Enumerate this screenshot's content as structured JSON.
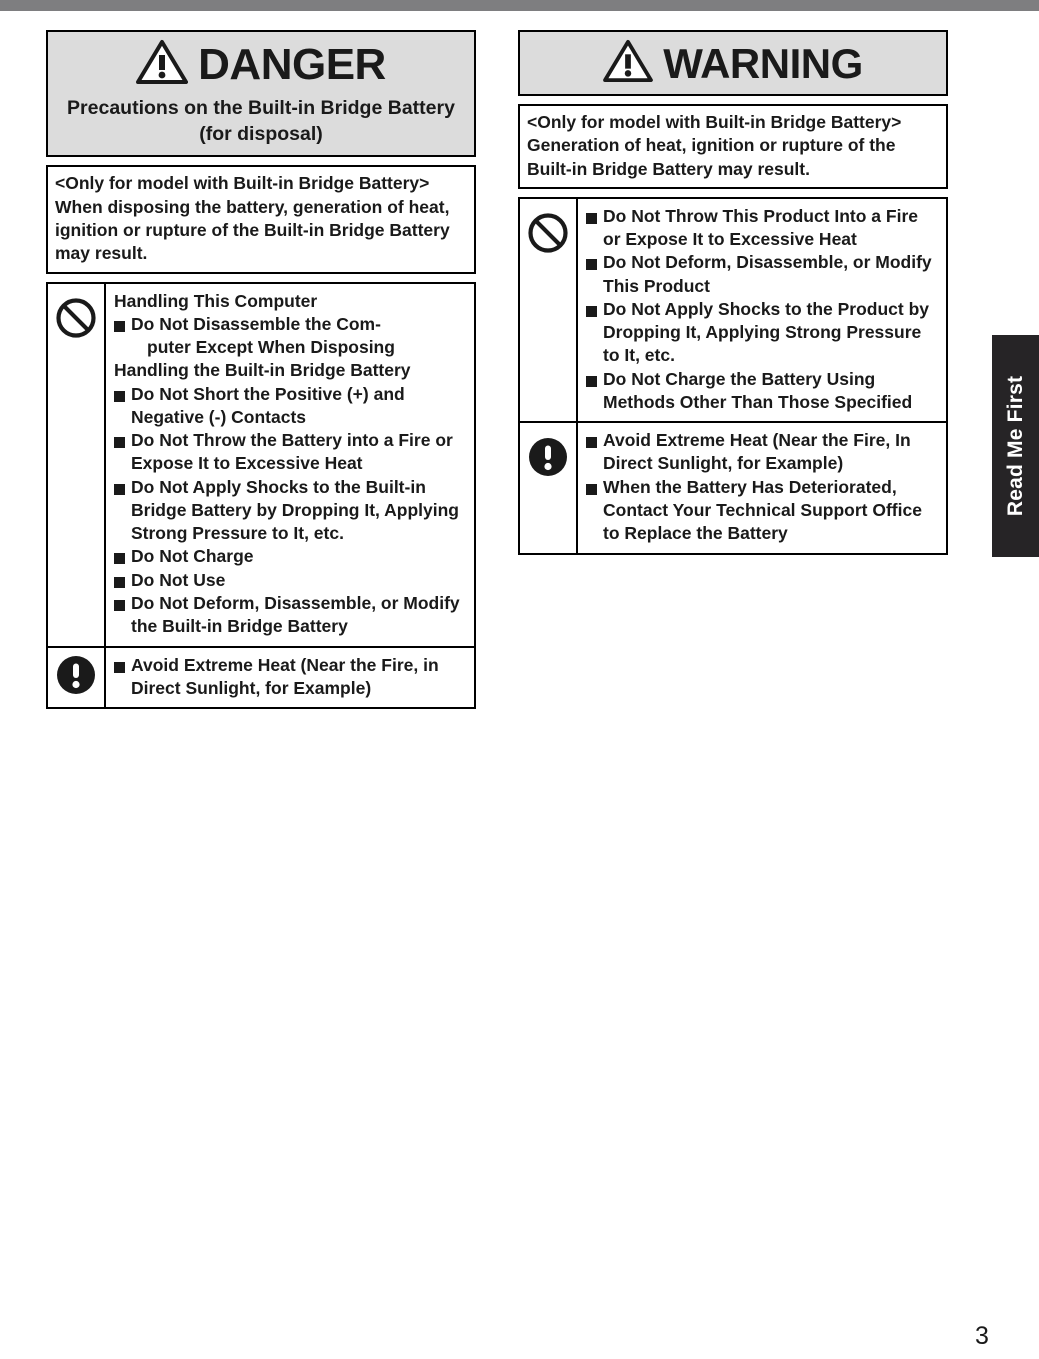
{
  "page": {
    "number": "3",
    "side_tab_label": "Read Me First"
  },
  "danger_panel": {
    "signal_word": "DANGER",
    "signal_icon": "warning-triangle-icon",
    "subtitle": "Precautions on the Built-in Bridge Battery (for disposal)",
    "statement": [
      "<Only for model with Built-in Bridge Battery>",
      "When disposing the battery, generation of heat, ignition or rupture of the Built-in Bridge Battery may result."
    ],
    "rows": [
      {
        "icon": "prohibition-icon",
        "heading_1": "Handling This Computer",
        "bullets_1": [
          {
            "main": "Do Not Disassemble the Com-",
            "cont": "puter Except When Disposing"
          }
        ],
        "heading_2": "Handling the Built-in Bridge Battery",
        "bullets_2": [
          "Do Not Short the Positive (+) and Negative (-) Contacts",
          "Do Not Throw the Battery into a Fire or Expose It to Excessive Heat",
          "Do Not Apply Shocks to the Built-in Bridge Battery by Dropping It, Applying Strong Pressure to It, etc.",
          "Do Not Charge",
          "Do Not Use",
          "Do Not Deform, Disassemble, or Modify the Built-in Bridge Battery"
        ]
      },
      {
        "icon": "mandatory-exclamation-icon",
        "bullets": [
          "Avoid Extreme Heat (Near the Fire, in Direct Sunlight, for Example)"
        ]
      }
    ]
  },
  "warning_panel": {
    "signal_word": "WARNING",
    "signal_icon": "warning-triangle-icon",
    "statement": [
      "<Only for model with Built-in Bridge Battery>",
      "Generation of heat, ignition or rupture of the Built-in Bridge Battery may result."
    ],
    "rows": [
      {
        "icon": "prohibition-icon",
        "bullets": [
          "Do Not Throw This Product Into a Fire or Expose It to Excessive Heat",
          "Do Not Deform, Disassemble, or Modify This Product",
          "Do Not Apply Shocks to the Product by Dropping It, Applying Strong Pressure to It, etc.",
          "Do Not Charge the Battery Using Methods Other Than Those Specified"
        ]
      },
      {
        "icon": "mandatory-exclamation-icon",
        "bullets": [
          "Avoid Extreme Heat (Near the Fire, In Direct Sunlight, for Example)",
          "When the Battery Has Deteriorated, Contact Your Technical Support Office to Replace the Battery"
        ]
      }
    ]
  },
  "colors": {
    "header_band": "#7e7e80",
    "signal_header_bg": "#dcdcdc",
    "ink": "#1a1a1a",
    "tab_bg": "#262426"
  }
}
